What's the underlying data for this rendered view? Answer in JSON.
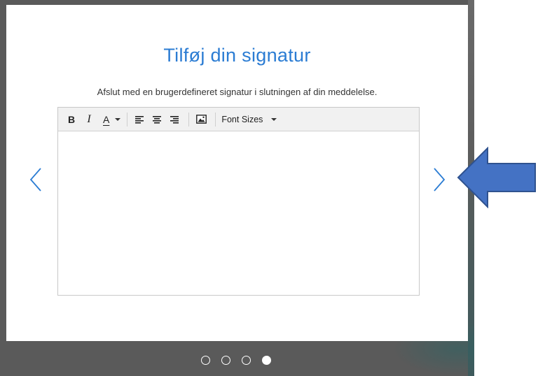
{
  "dialog": {
    "title": "Tilføj din signatur",
    "subtitle": "Afslut med en brugerdefineret signatur i slutningen af din meddelelse."
  },
  "toolbar": {
    "bold_label": "B",
    "italic_label": "I",
    "font_color_label": "A",
    "font_sizes_label": "Font Sizes",
    "icons": [
      "bold",
      "italic",
      "font-color",
      "align-left-icon",
      "align-center-icon",
      "align-right-icon",
      "insert-image-icon"
    ]
  },
  "pager": {
    "total": 4,
    "active_index": 3
  },
  "colors": {
    "accent": "#2b7cd3",
    "annotation_arrow": "#4472c4",
    "frame": "#5a5a5a"
  }
}
